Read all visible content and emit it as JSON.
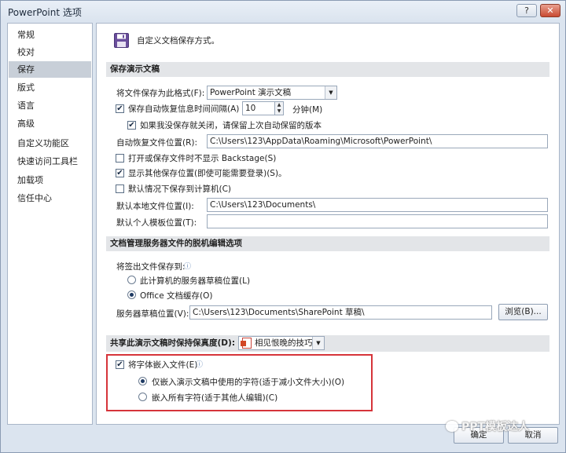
{
  "window": {
    "title": "PowerPoint 选项",
    "help_label": "?",
    "close_label": "✕"
  },
  "sidebar": {
    "items": [
      {
        "label": "常规"
      },
      {
        "label": "校对"
      },
      {
        "label": "保存"
      },
      {
        "label": "版式"
      },
      {
        "label": "语言"
      },
      {
        "label": "高级"
      },
      {
        "label": "自定义功能区"
      },
      {
        "label": "快速访问工具栏"
      },
      {
        "label": "加载项"
      },
      {
        "label": "信任中心"
      }
    ],
    "selected": "保存"
  },
  "header": {
    "text": "自定义文档保存方式。",
    "icon": "save-icon"
  },
  "save_presentations": {
    "section_title": "保存演示文稿",
    "format_label": "将文件保存为此格式(F):",
    "format_value": "PowerPoint 演示文稿",
    "autorecover_label": "保存自动恢复信息时间间隔(A)",
    "autorecover_minutes": "10",
    "minutes_label": "分钟(M)",
    "keep_last_label": "如果我没保存就关闭，请保留上次自动保留的版本",
    "autorecover_location_label": "自动恢复文件位置(R):",
    "autorecover_location_value": "C:\\Users\\123\\AppData\\Roaming\\Microsoft\\PowerPoint\\",
    "no_backstage_label": "打开或保存文件时不显示 Backstage(S)",
    "show_more_locations_label": "显示其他保存位置(即使可能需要登录)(S)。",
    "save_to_computer_label": "默认情况下保存到计算机(C)",
    "default_location_label": "默认本地文件位置(I):",
    "default_location_value": "C:\\Users\\123\\Documents\\",
    "template_location_label": "默认个人模板位置(T):",
    "template_location_value": ""
  },
  "offline_editing": {
    "section_title": "文档管理服务器文件的脱机编辑选项",
    "checkout_label": "将签出文件保存到:",
    "server_drafts_label": "此计算机的服务器草稿位置(L)",
    "office_cache_label": "Office 文档缓存(O)",
    "drafts_location_label": "服务器草稿位置(V):",
    "drafts_location_value": "C:\\Users\\123\\Documents\\SharePoint 草稿\\",
    "browse_label": "浏览(B)..."
  },
  "fidelity": {
    "section_title": "共享此演示文稿时保持保真度(D):",
    "document_value": "相见恨晚的技巧",
    "embed_fonts_label": "将字体嵌入文件(E)",
    "embed_used_label": "仅嵌入演示文稿中使用的字符(适于减小文件大小)(O)",
    "embed_all_label": "嵌入所有字符(适于其他人编辑)(C)"
  },
  "footer": {
    "ok_label": "确定",
    "cancel_label": "取消"
  },
  "watermark": {
    "text": "PPT模板达人"
  },
  "colors": {
    "highlight": "#d6343a",
    "accent": "#2b579a",
    "window_bg": "#dbe4ef"
  }
}
